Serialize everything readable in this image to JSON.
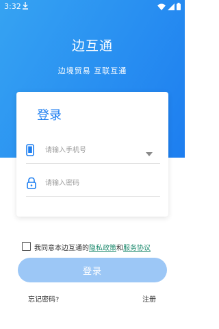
{
  "status_bar": {
    "time": "3:32"
  },
  "header": {
    "title": "边互通",
    "subtitle": "边境贸易 互联互通"
  },
  "login_card": {
    "title": "登录",
    "phone_placeholder": "请输入手机号",
    "password_placeholder": "请输入密码"
  },
  "agreement": {
    "prefix": "我同意本边互通的",
    "privacy_link": "隐私政策",
    "and": "和",
    "service_link": "服务协议"
  },
  "login_button": "登录",
  "forgot_password": "忘记密码?",
  "register": "注册",
  "colors": {
    "primary": "#1d7ef0",
    "header_gradient_start": "#36a3f2",
    "button_disabled": "#9cc7f6",
    "link": "#1d8a6e"
  },
  "icons": [
    "download-icon",
    "wifi-icon",
    "signal-icon",
    "battery-icon",
    "phone-icon",
    "lock-icon",
    "dropdown-caret-icon"
  ]
}
